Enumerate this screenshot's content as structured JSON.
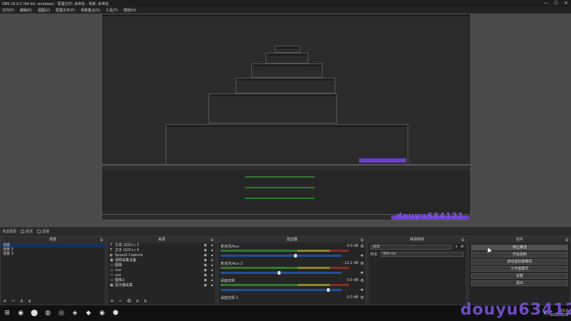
{
  "window": {
    "title": "OBS 26.0.2 (64-bit, windows) - 配置文件: 未命名 - 场景: 未命名",
    "minimize": "—",
    "maximize": "☐",
    "close": "✕"
  },
  "menu": [
    "文件(F)",
    "编辑(E)",
    "视图(V)",
    "配置文件(P)",
    "场景集合(S)",
    "工具(T)",
    "帮助(H)"
  ],
  "preview": {
    "watermark_small": "douyu634121"
  },
  "scene_tabs": {
    "label": "未选择源",
    "properties": "属性",
    "filters": "滤镜"
  },
  "docks": {
    "scenes": {
      "title": "场景",
      "items": [
        "场景",
        "场景 2",
        "场景 3"
      ],
      "selected_index": 0,
      "footer": [
        "+",
        "−",
        "∧",
        "∨"
      ]
    },
    "sources": {
      "title": "来源",
      "items": [
        {
          "icon": "T",
          "name": "文本 (GDI+) 2"
        },
        {
          "icon": "T",
          "name": "文本 (GDI+) 4"
        },
        {
          "icon": "◐",
          "name": "Spout2 Capture"
        },
        {
          "icon": "▣",
          "name": "视频采集设备"
        },
        {
          "icon": "▭",
          "name": "图像"
        },
        {
          "icon": "▭",
          "name": "xxx"
        },
        {
          "icon": "▭",
          "name": "xxx"
        },
        {
          "icon": "▭",
          "name": "图像2"
        },
        {
          "icon": "▣",
          "name": "显示器采集"
        }
      ],
      "footer": [
        "+",
        "−",
        "⚙",
        "∧",
        "∨"
      ]
    },
    "mixer": {
      "title": "混音器",
      "channels": [
        {
          "name": "麦克风/Aux",
          "db": "0.0 dB",
          "level": 0.62
        },
        {
          "name": "麦克风/Aux 2",
          "db": "-12.2 dB",
          "level": 0.48
        },
        {
          "name": "桌面音频",
          "db": "0.0 dB",
          "level": 0.9
        },
        {
          "name": "桌面音频 2",
          "db": "0.0 dB",
          "level": 0.9
        }
      ]
    },
    "transitions": {
      "title": "转场特效",
      "type": "淡出",
      "duration_label": "时长",
      "duration_value": "300 ms"
    },
    "controls": {
      "title": "控件",
      "buttons": [
        "停止推流",
        "开始录制",
        "启动虚拟摄像机",
        "工作室模式",
        "设置",
        "退出"
      ],
      "active_index": 0
    }
  },
  "taskbar": {
    "icons": [
      "⊞",
      "◉",
      "⬤",
      "◍",
      "◎",
      "◈",
      "◆",
      "◉",
      "⬢"
    ],
    "tray_text": "英",
    "time": "10:0",
    "date": "2022/1/26",
    "watermark": "douyu634121"
  },
  "colors": {
    "bg": "#2b2b2b",
    "preview_bg": "#4a4a4a",
    "selected": "#15325a",
    "slider": "#1f4f9a",
    "watermark": "#7d57e6"
  }
}
